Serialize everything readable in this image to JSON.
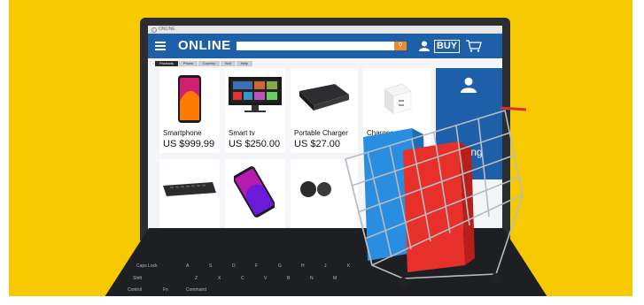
{
  "browser": {
    "tab_label": "ONLINE"
  },
  "store": {
    "name": "ONLINE",
    "search": {
      "placeholder": ""
    },
    "buy_label": "BUY",
    "accent_color": "#1d5fa8",
    "search_button_color": "#f0892a"
  },
  "tabs": [
    "Products",
    "Prices",
    "Country",
    "Sell",
    "Help"
  ],
  "products": [
    {
      "name": "Smartphone",
      "price": "US $999.99"
    },
    {
      "name": "Smart tv",
      "price": "US $250.00"
    },
    {
      "name": "Portable Charger",
      "price": "US $27.00"
    },
    {
      "name": "Charger",
      "price": "U"
    }
  ],
  "promo": {
    "text": "ping"
  },
  "keyboard": {
    "labels": [
      "Caps Lock",
      "Shift",
      "Control",
      "Fn",
      "Command"
    ],
    "letters": [
      "A",
      "S",
      "D",
      "F",
      "G",
      "H",
      "J",
      "K",
      "Z",
      "X",
      "C",
      "V",
      "B",
      "N",
      "M"
    ]
  },
  "icons": [
    "menu-icon",
    "search-icon",
    "user-icon",
    "cart-icon",
    "shopping-cart-icon",
    "smartphone-icon",
    "tv-icon",
    "charger-icon"
  ]
}
